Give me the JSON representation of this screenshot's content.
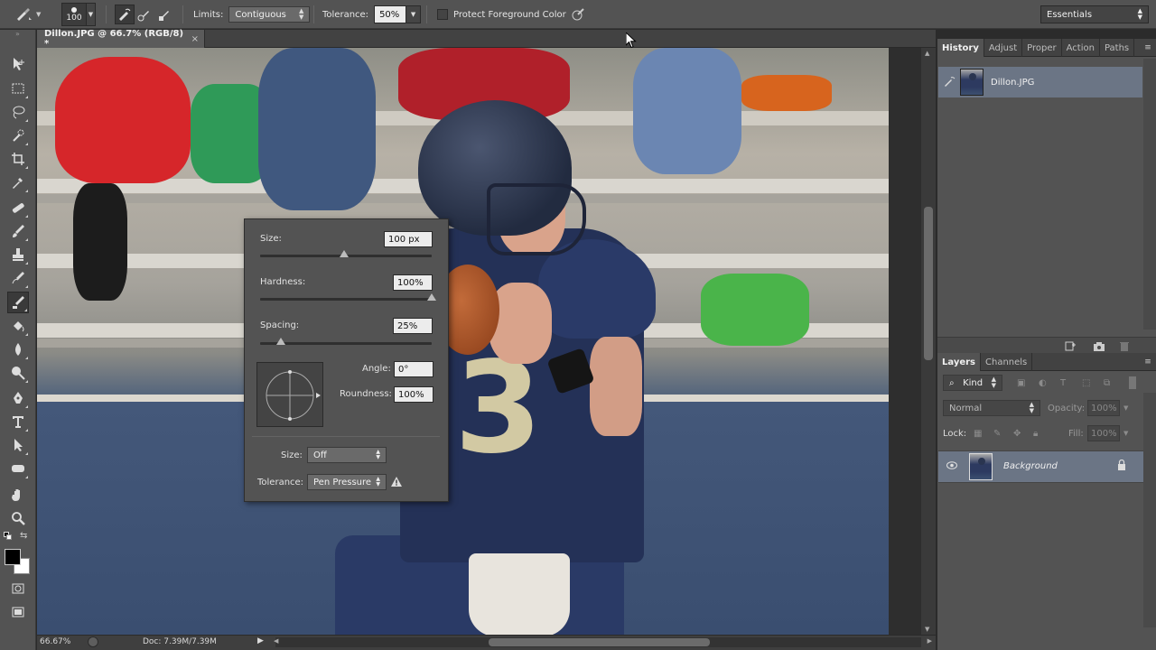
{
  "options_bar": {
    "brush_size": "100",
    "limits_label": "Limits:",
    "limits_value": "Contiguous",
    "tolerance_label": "Tolerance:",
    "tolerance_value": "50%",
    "protect_fg_label": "Protect Foreground Color",
    "workspace": "Essentials"
  },
  "document": {
    "tab_title": "Dillon.JPG @ 66.7% (RGB/8) *",
    "close_glyph": "×",
    "jersey_number": "3"
  },
  "brush_popup": {
    "size_label": "Size:",
    "size_value": "100 px",
    "size_slider": 0.49,
    "hardness_label": "Hardness:",
    "hardness_value": "100%",
    "hardness_slider": 1.0,
    "spacing_label": "Spacing:",
    "spacing_value": "25%",
    "spacing_slider": 0.12,
    "angle_label": "Angle:",
    "angle_value": "0°",
    "roundness_label": "Roundness:",
    "roundness_value": "100%",
    "size_control_label": "Size:",
    "size_control_value": "Off",
    "tolerance_control_label": "Tolerance:",
    "tolerance_control_value": "Pen Pressure"
  },
  "status_bar": {
    "zoom": "66.67%",
    "doc": "Doc: 7.39M/7.39M"
  },
  "history_panel": {
    "tabs": [
      "History",
      "Adjust",
      "Proper",
      "Action",
      "Paths"
    ],
    "snapshot_name": "Dillon.JPG"
  },
  "layers_panel": {
    "tabs": [
      "Layers",
      "Channels"
    ],
    "kind": "Kind",
    "blend_mode": "Normal",
    "opacity_label": "Opacity:",
    "opacity_value": "100%",
    "lock_label": "Lock:",
    "fill_label": "Fill:",
    "fill_value": "100%",
    "layer_name": "Background"
  },
  "colors": {
    "foreground": "#000000",
    "background": "#ffffff",
    "selection_row": "#6b7585"
  }
}
